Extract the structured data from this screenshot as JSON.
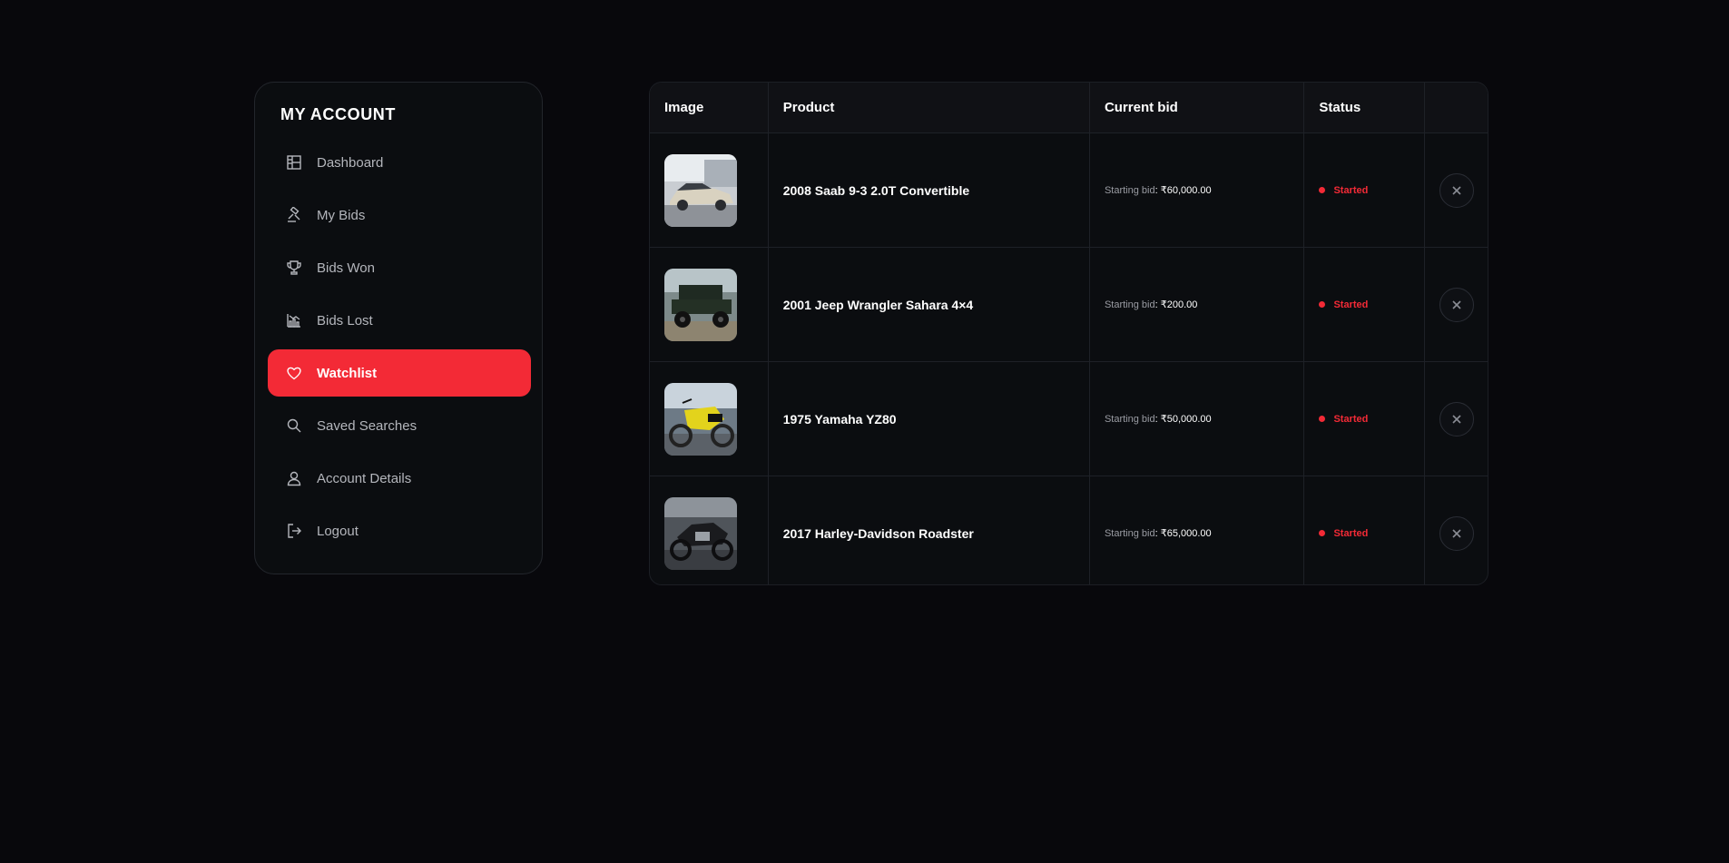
{
  "sidebar": {
    "title": "MY ACCOUNT",
    "items": [
      {
        "label": "Dashboard",
        "icon": "dashboard-icon",
        "active": false
      },
      {
        "label": "My Bids",
        "icon": "gavel-icon",
        "active": false
      },
      {
        "label": "Bids Won",
        "icon": "trophy-icon",
        "active": false
      },
      {
        "label": "Bids Lost",
        "icon": "chart-down-icon",
        "active": false
      },
      {
        "label": "Watchlist",
        "icon": "heart-icon",
        "active": true
      },
      {
        "label": "Saved Searches",
        "icon": "search-icon",
        "active": false
      },
      {
        "label": "Account Details",
        "icon": "user-icon",
        "active": false
      },
      {
        "label": "Logout",
        "icon": "logout-icon",
        "active": false
      }
    ]
  },
  "table": {
    "headers": {
      "image": "Image",
      "product": "Product",
      "current_bid": "Current bid",
      "status": "Status"
    },
    "rows": [
      {
        "product": "2008 Saab 9-3 2.0T Convertible",
        "bid_label": "Starting bid",
        "bid_amount": ": ₹60,000.00",
        "status": "Started",
        "thumb": "silver-convertible-photo"
      },
      {
        "product": "2001 Jeep Wrangler Sahara 4×4",
        "bid_label": "Starting bid",
        "bid_amount": ": ₹200.00",
        "status": "Started",
        "thumb": "green-jeep-photo"
      },
      {
        "product": "1975 Yamaha YZ80",
        "bid_label": "Starting bid",
        "bid_amount": ": ₹50,000.00",
        "status": "Started",
        "thumb": "yellow-dirtbike-photo"
      },
      {
        "product": "2017 Harley-Davidson Roadster",
        "bid_label": "Starting bid",
        "bid_amount": ": ₹65,000.00",
        "status": "Started",
        "thumb": "black-motorcycle-photo"
      }
    ]
  },
  "colors": {
    "accent": "#f32a36",
    "background": "#08080c",
    "panel": "#0b0d10"
  }
}
